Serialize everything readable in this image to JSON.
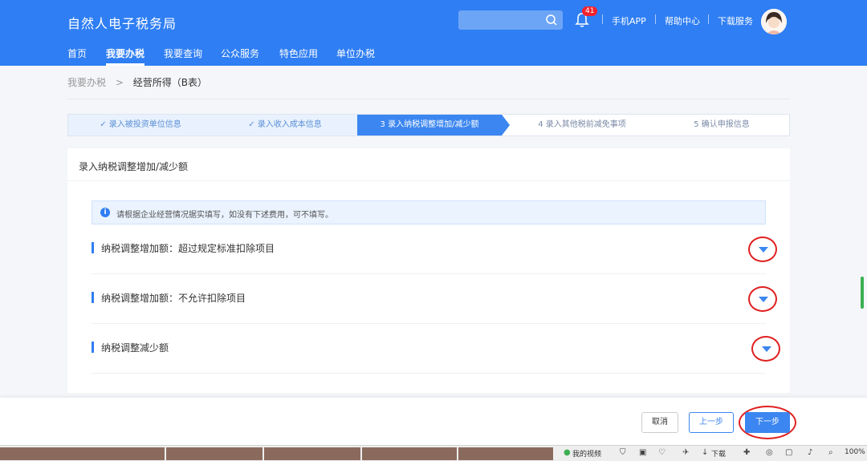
{
  "header": {
    "brand": "自然人电子税务局",
    "badge_count": "41",
    "links": [
      "手机APP",
      "帮助中心",
      "下载服务"
    ]
  },
  "nav": {
    "items": [
      "首页",
      "我要办税",
      "我要查询",
      "公众服务",
      "特色应用",
      "单位办税"
    ],
    "active_index": 1
  },
  "breadcrumb": {
    "parent": "我要办税",
    "separator": ">",
    "current": "经营所得（B表）"
  },
  "steps": [
    {
      "label": "✓ 录入被投资单位信息",
      "state": "done"
    },
    {
      "label": "✓ 录入收入成本信息",
      "state": "done"
    },
    {
      "label": "3  录入纳税调整增加/减少额",
      "state": "active"
    },
    {
      "label": "4  录入其他税前减免事项",
      "state": "todo"
    },
    {
      "label": "5  确认申报信息",
      "state": "todo"
    }
  ],
  "card": {
    "title": "录入纳税调整增加/减少额",
    "notice_icon": "i",
    "notice": "请根据企业经营情况据实填写，如没有下述费用，可不填写。",
    "sections": [
      "纳税调整增加额：超过规定标准扣除项目",
      "纳税调整增加额：不允许扣除项目",
      "纳税调整减少额"
    ]
  },
  "footer": {
    "cancel": "取消",
    "prev": "上一步",
    "next": "下一步"
  },
  "taskbar": {
    "video": "我的视频",
    "download": "下载",
    "zoom": "100%"
  },
  "colors": {
    "header": "#2f7ef3",
    "accent": "#3b86f0",
    "annotation": "#e02020"
  }
}
